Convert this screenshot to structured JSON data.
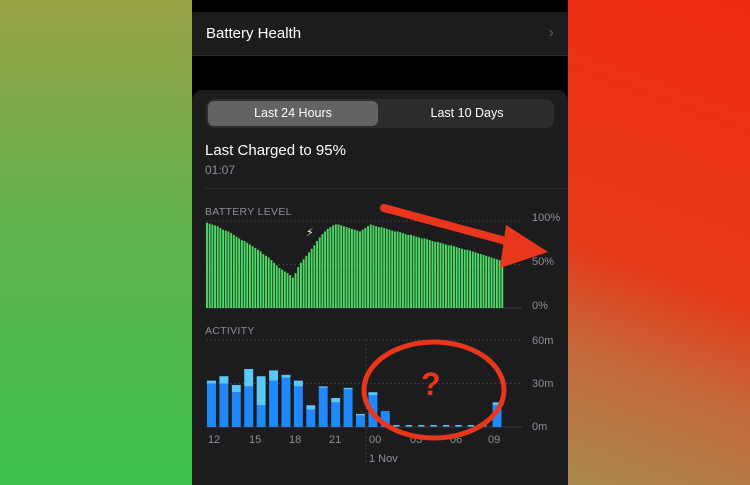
{
  "battery_health": {
    "label": "Battery Health"
  },
  "segment": {
    "active": "Last 24 Hours",
    "inactive": "Last 10 Days"
  },
  "last_charged": {
    "title": "Last Charged to 95%",
    "time": "01:07"
  },
  "battery_level": {
    "title": "BATTERY LEVEL",
    "y_ticks": [
      "100%",
      "50%",
      "0%"
    ],
    "bars_percent": [
      98,
      97,
      96,
      95,
      94,
      92,
      90,
      89,
      88,
      86,
      84,
      82,
      80,
      78,
      77,
      75,
      73,
      71,
      69,
      67,
      65,
      62,
      60,
      58,
      55,
      52,
      49,
      46,
      44,
      42,
      40,
      38,
      35,
      40,
      47,
      52,
      56,
      60,
      64,
      68,
      72,
      77,
      81,
      85,
      88,
      91,
      93,
      95,
      96,
      96,
      95,
      94,
      93,
      92,
      91,
      90,
      89,
      88,
      90,
      92,
      94,
      96,
      95,
      94,
      93,
      93,
      92,
      91,
      90,
      89,
      88,
      88,
      87,
      86,
      85,
      84,
      84,
      83,
      82,
      81,
      80,
      80,
      79,
      78,
      77,
      76,
      76,
      75,
      74,
      73,
      72,
      72,
      71,
      70,
      69,
      68,
      67,
      67,
      66,
      65,
      64,
      63,
      62,
      61,
      60,
      59,
      58,
      57,
      56,
      55,
      54
    ],
    "charging_color": "#4cd964"
  },
  "activity": {
    "title": "ACTIVITY",
    "y_ticks": [
      "60m",
      "30m",
      "0m"
    ],
    "x_ticks": [
      "12",
      "15",
      "18",
      "21",
      "00",
      "03",
      "06",
      "09"
    ],
    "date_label": "1 Nov",
    "screen_on_minutes": [
      30,
      30,
      24,
      28,
      15,
      32,
      34,
      28,
      12,
      27,
      17,
      26,
      8,
      22,
      0,
      0,
      0,
      0,
      0,
      0,
      0,
      0,
      0,
      15
    ],
    "screen_off_minutes": [
      2,
      5,
      5,
      12,
      20,
      7,
      2,
      4,
      3,
      1,
      3,
      1,
      1,
      2,
      11,
      0,
      0,
      0,
      0,
      0,
      0,
      0,
      0,
      2
    ],
    "screen_on_color": "#1f88fd",
    "screen_off_color": "#5ac8fa"
  },
  "annotation": {
    "text": "?",
    "color": "#e8351c"
  }
}
